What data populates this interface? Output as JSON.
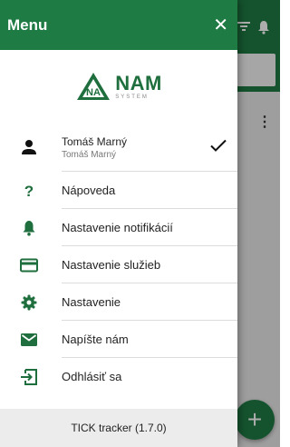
{
  "drawer": {
    "title": "Menu",
    "close_label": "✕",
    "logo": {
      "main": "NAM",
      "sub": "SYSTEM"
    },
    "user": {
      "name": "Tomáš Marný",
      "sub": "Tomáš Marný"
    },
    "items": [
      {
        "label": "Nápoveda",
        "icon": "help-icon"
      },
      {
        "label": "Nastavenie notifikácií",
        "icon": "bell-icon"
      },
      {
        "label": "Nastavenie služieb",
        "icon": "credit-card-icon"
      },
      {
        "label": "Nastavenie",
        "icon": "gear-icon"
      },
      {
        "label": "Napíšte nám",
        "icon": "mail-icon"
      },
      {
        "label": "Odhlásiť sa",
        "icon": "logout-icon"
      }
    ],
    "footer": "TICK tracker (1.7.0)"
  },
  "background": {
    "fab_label": "+"
  },
  "colors": {
    "primary": "#1e7b43",
    "icon_green": "#1f6e3d"
  }
}
